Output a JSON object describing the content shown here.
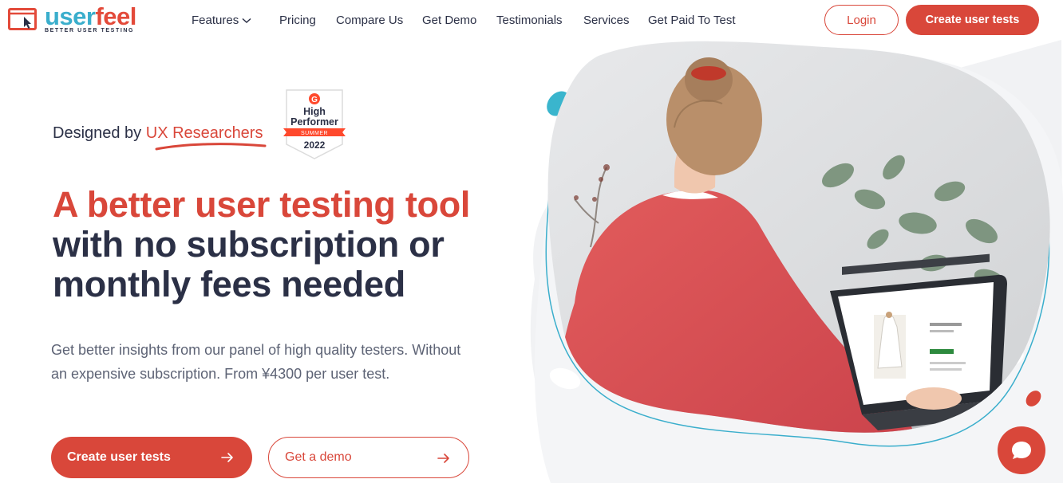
{
  "brand": {
    "name_part1": "user",
    "name_part2": "feel",
    "tagline": "BETTER USER TESTING",
    "primary_color": "#d9473a",
    "secondary_color": "#3aaecc",
    "text_color": "#2b3046"
  },
  "nav": {
    "items": [
      {
        "label": "Features",
        "icon": "chevron-down-icon"
      },
      {
        "label": "Pricing"
      },
      {
        "label": "Compare Us"
      },
      {
        "label": "Get Demo"
      },
      {
        "label": "Testimonials"
      },
      {
        "label": "Services"
      },
      {
        "label": "Get Paid To Test"
      }
    ],
    "login_label": "Login",
    "create_label": "Create user tests"
  },
  "hero": {
    "designed_prefix": "Designed by",
    "designed_accent": "UX Researchers",
    "badge": {
      "brand": "G",
      "line1": "High",
      "line2": "Performer",
      "season": "SUMMER",
      "year": "2022"
    },
    "headline_line1": "A better user testing tool",
    "headline_line2": "with no subscription or",
    "headline_line3": "monthly fees needed",
    "subtext": "Get better insights from our panel of high quality testers. Without an expensive subscription. From ¥4300 per user test.",
    "cta_primary": "Create user tests",
    "cta_secondary": "Get a demo",
    "image_subject": "woman-using-laptop-photo"
  },
  "chat": {
    "icon": "chat-bubble-icon"
  }
}
